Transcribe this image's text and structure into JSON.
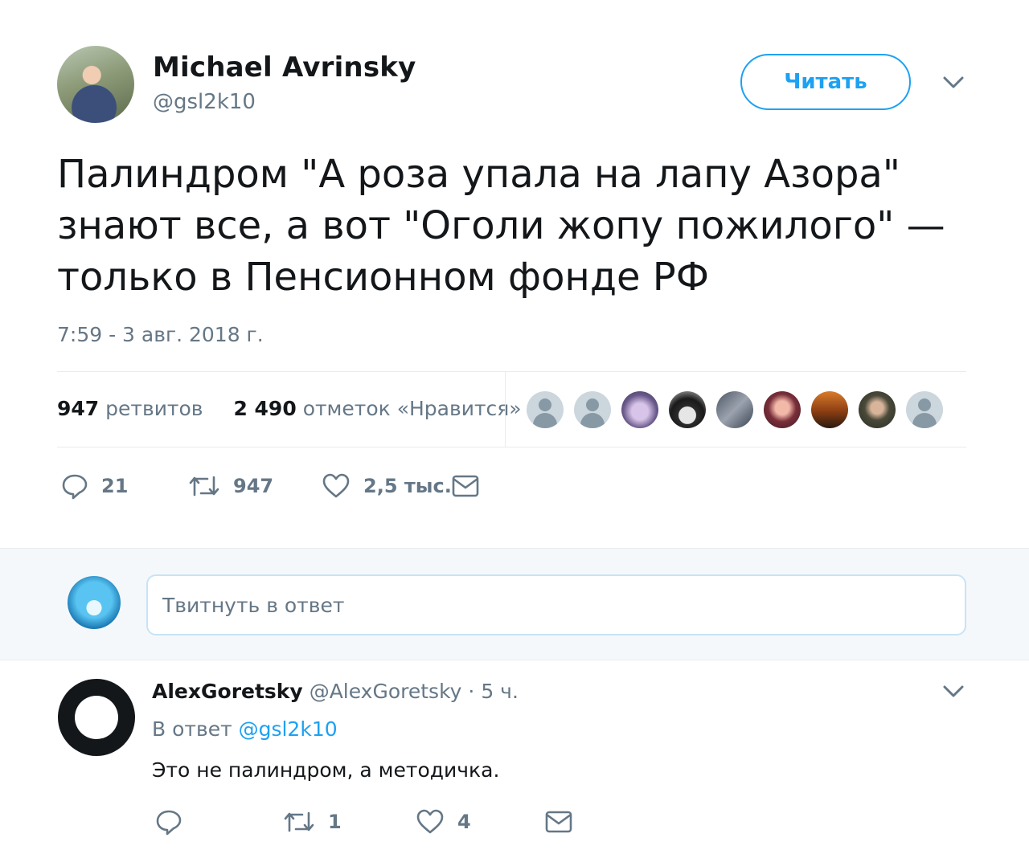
{
  "tweet": {
    "author_name": "Michael Avrinsky",
    "author_handle": "@gsl2k10",
    "follow_label": "Читать",
    "text": "Палиндром \"А роза упала на лапу Азора\"\nзнают все, а вот \"Оголи жопу пожилого\" —\nтолько в Пенсионном фонде РФ",
    "timestamp": "7:59 - 3 авг. 2018 г.",
    "stats": {
      "retweets_count": "947",
      "retweets_label": "ретвитов",
      "likes_count": "2 490",
      "likes_label": "отметок «Нравится»"
    },
    "actions": {
      "replies": "21",
      "retweets": "947",
      "likes": "2,5 тыс."
    }
  },
  "composer": {
    "placeholder": "Твитнуть в ответ"
  },
  "reply": {
    "author_name": "AlexGoretsky",
    "author_handle": "@AlexGoretsky",
    "time": "· 5 ч.",
    "reply_to_prefix": "В ответ",
    "reply_to_handle": "@gsl2k10",
    "text": "Это не палиндром, а методичка.",
    "actions": {
      "retweets": "1",
      "likes": "4"
    }
  },
  "colors": {
    "accent": "#1da1f2",
    "secondary_text": "#657786",
    "primary_text": "#14171a",
    "divider": "#e6ecf0",
    "composer_bg": "#f5f8fa"
  },
  "icons": [
    "chevron-down-icon",
    "reply-icon",
    "retweet-icon",
    "like-icon",
    "direct-message-icon",
    "default-avatar-icon"
  ]
}
